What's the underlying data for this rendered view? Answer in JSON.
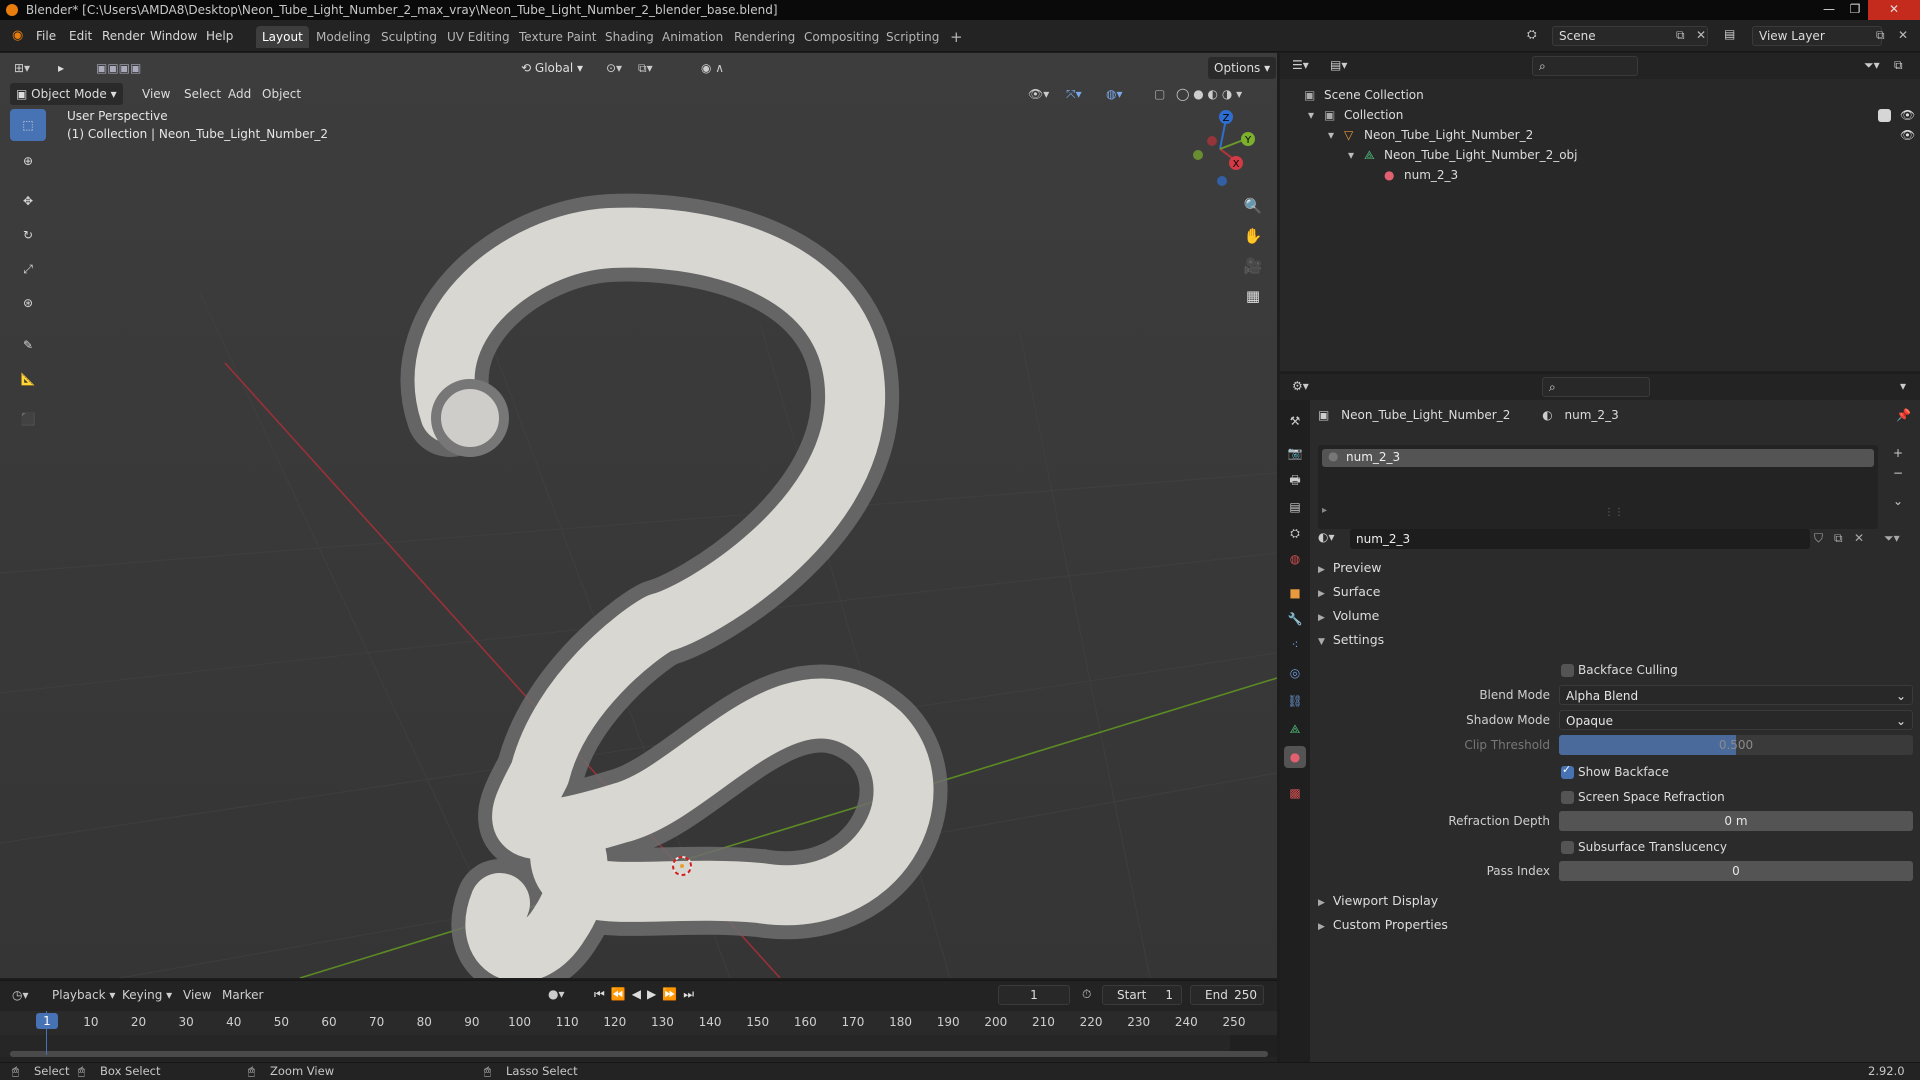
{
  "window": {
    "title": "Blender* [C:\\Users\\AMDA8\\Desktop\\Neon_Tube_Light_Number_2_max_vray\\Neon_Tube_Light_Number_2_blender_base.blend]"
  },
  "menubar": {
    "items": [
      "File",
      "Edit",
      "Render",
      "Window",
      "Help"
    ],
    "workspaces": [
      "Layout",
      "Modeling",
      "Sculpting",
      "UV Editing",
      "Texture Paint",
      "Shading",
      "Animation",
      "Rendering",
      "Compositing",
      "Scripting"
    ],
    "active_workspace": "Layout",
    "scene": "Scene",
    "view_layer": "View Layer"
  },
  "viewport": {
    "mode": "Object Mode",
    "menus": [
      "View",
      "Select",
      "Add",
      "Object"
    ],
    "transform_orientation": "Global",
    "options_label": "Options",
    "perspective_text": "User Perspective",
    "collection_text": "(1) Collection | Neon_Tube_Light_Number_2",
    "gizmo_axes": {
      "x": "X",
      "y": "Y",
      "z": "Z"
    }
  },
  "outliner": {
    "rows": [
      {
        "label": "Scene Collection",
        "icon": "collection-icon"
      },
      {
        "label": "Collection",
        "icon": "collection-icon"
      },
      {
        "label": "Neon_Tube_Light_Number_2",
        "icon": "object-icon"
      },
      {
        "label": "Neon_Tube_Light_Number_2_obj",
        "icon": "mesh-icon"
      },
      {
        "label": "num_2_3",
        "icon": "material-icon"
      }
    ]
  },
  "properties": {
    "breadcrumb_object": "Neon_Tube_Light_Number_2",
    "breadcrumb_material": "num_2_3",
    "slot_name": "num_2_3",
    "material_name": "num_2_3",
    "sections": {
      "preview": "Preview",
      "surface": "Surface",
      "volume": "Volume",
      "settings": "Settings",
      "viewport_display": "Viewport Display",
      "custom_properties": "Custom Properties"
    },
    "settings": {
      "backface_culling": "Backface Culling",
      "blend_mode_label": "Blend Mode",
      "blend_mode_value": "Alpha Blend",
      "shadow_mode_label": "Shadow Mode",
      "shadow_mode_value": "Opaque",
      "clip_threshold_label": "Clip Threshold",
      "clip_threshold_value": "0.500",
      "clip_threshold_fraction": 0.5,
      "show_backface": "Show Backface",
      "screen_space_refraction": "Screen Space Refraction",
      "refraction_depth_label": "Refraction Depth",
      "refraction_depth_value": "0 m",
      "subsurface_translucency": "Subsurface Translucency",
      "pass_index_label": "Pass Index",
      "pass_index_value": "0"
    }
  },
  "timeline": {
    "menus": [
      "Playback",
      "Keying",
      "View",
      "Marker"
    ],
    "current_frame": "1",
    "start_label": "Start",
    "start_value": "1",
    "end_label": "End",
    "end_value": "250",
    "ticks": [
      "1",
      "10",
      "20",
      "30",
      "40",
      "50",
      "60",
      "70",
      "80",
      "90",
      "100",
      "110",
      "120",
      "130",
      "140",
      "150",
      "160",
      "170",
      "180",
      "190",
      "200",
      "210",
      "220",
      "230",
      "240",
      "250"
    ]
  },
  "statusbar": {
    "select": "Select",
    "box_select": "Box Select",
    "zoom_view": "Zoom View",
    "lasso_select": "Lasso Select",
    "version": "2.92.0"
  },
  "colors": {
    "accent": "#4772b3",
    "axis_x": "#b8323b",
    "axis_y": "#6b9a2a",
    "axis_z": "#2f6ed1"
  }
}
